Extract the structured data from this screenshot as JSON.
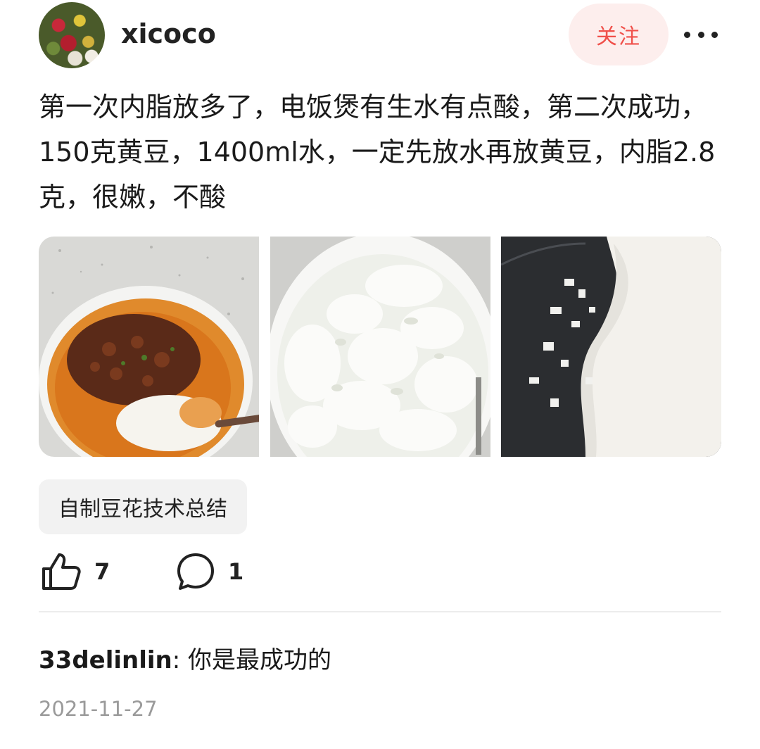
{
  "header": {
    "username": "xicoco",
    "follow_label": "关注",
    "avatar_icon": "avatar-image",
    "more_icon": "more-dots-icon"
  },
  "post": {
    "text": "第一次内脂放多了，电饭煲有生水有点酸，第二次成功，150克黄豆，1400ml水，一定先放水再放黄豆，内脂2.8克，很嫩，不酸",
    "photos": [
      "tofu-pudding-with-chili-sauce",
      "tofu-pudding-in-bowl",
      "soy-milk-in-rice-cooker-pot"
    ],
    "tag": "自制豆花技术总结"
  },
  "stats": {
    "likes": "7",
    "comments": "1",
    "like_icon": "thumbs-up-icon",
    "comment_icon": "comment-bubble-icon"
  },
  "comment": {
    "user": "33delinlin",
    "separator": ": ",
    "text": "你是最成功的"
  },
  "date": "2021-11-27",
  "colors": {
    "follow_text": "#f0504a",
    "follow_bg": "#fdeeed",
    "tag_bg": "#f2f2f2",
    "date_text": "#9a9a9a"
  }
}
